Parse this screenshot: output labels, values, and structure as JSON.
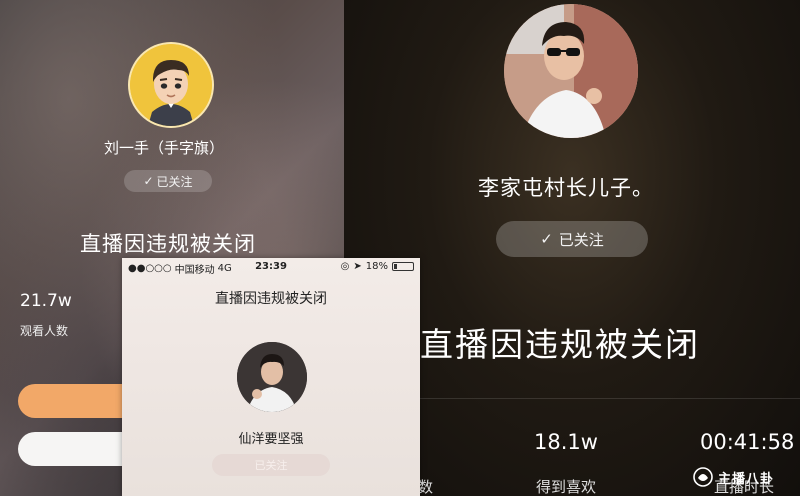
{
  "left_panel": {
    "streamer_name": "刘一手（手字旗）",
    "follow_label": "已关注",
    "title": "直播因违规被关闭",
    "stat_value": "21.7w",
    "stat_label": "观看人数"
  },
  "right_panel": {
    "streamer_name": "李家屯村长儿子。",
    "follow_label": "已关注",
    "title": "直播因违规被关闭",
    "stats": [
      {
        "value": "",
        "label": "数"
      },
      {
        "value": "18.1w",
        "label": "得到喜欢"
      },
      {
        "value": "00:41:58",
        "label": "直播时长"
      }
    ],
    "watermark": "主播八卦"
  },
  "phone": {
    "status_bar": {
      "carrier": "中国移动",
      "network": "4G",
      "time": "23:39",
      "battery_text": "18%",
      "battery_level": 0.18
    },
    "title": "直播因违规被关闭",
    "streamer_name": "仙洋要坚强",
    "follow_label": "已关注"
  },
  "colors": {
    "orange_button": "#f2a868",
    "avatar_yellow": "#f0c43c"
  },
  "icons": [
    "check-icon",
    "signal-dots-icon",
    "location-icon",
    "lock-rotation-icon",
    "battery-icon",
    "watermark-logo-icon"
  ]
}
